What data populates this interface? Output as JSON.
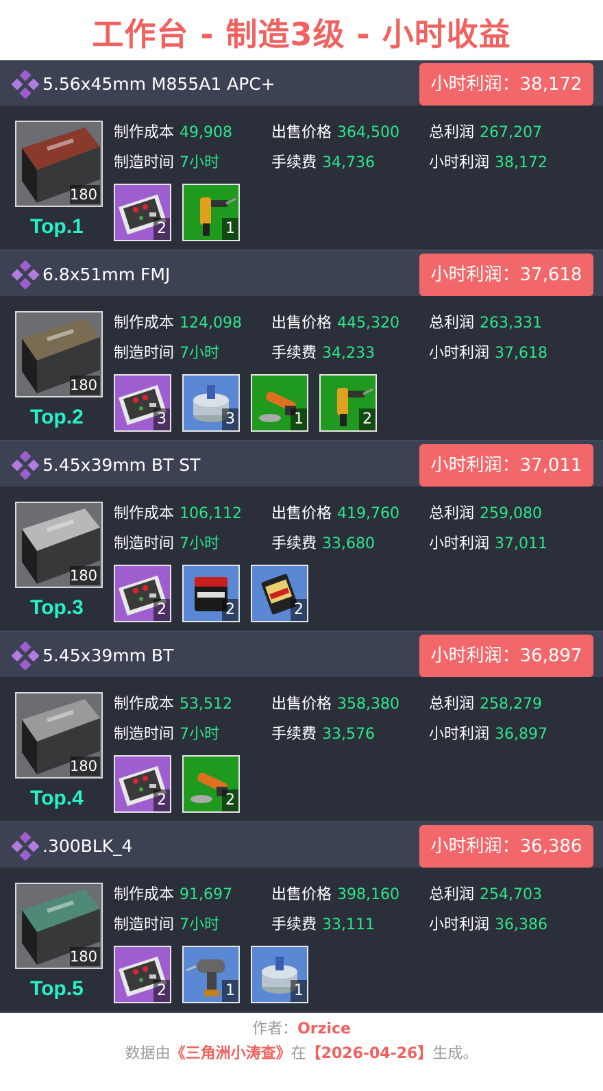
{
  "title": "工作台 - 制造3级 - 小时收益",
  "labels": {
    "cost": "制作成本",
    "price": "出售价格",
    "total": "总利润",
    "time": "制造时间",
    "fee": "手续费",
    "hourly": "小时利润"
  },
  "colors": {
    "title": "#f0625f",
    "card_bg": "#2b2f3a",
    "header_bg": "#3c4253",
    "badge": "#f2686a",
    "value": "#2de68a",
    "rank": "#25f3c9",
    "mat_purple": "#9f5ed0",
    "mat_green": "#1f9a1f",
    "mat_blue": "#5a88d4"
  },
  "items": [
    {
      "name": "5.56x45mm M855A1 APC+",
      "badge": "小时利润：38,172",
      "cost": "49,908",
      "price": "364,500",
      "total": "267,207",
      "time": "7小时",
      "fee": "34,736",
      "hourly": "38,172",
      "count": "180",
      "rank": "Top.1",
      "box_color": "#8a3a2a",
      "materials": [
        {
          "icon": "circuit-board-icon",
          "bg": "#9f5ed0",
          "count": "2"
        },
        {
          "icon": "soldering-gun-icon",
          "bg": "#1f9a1f",
          "count": "1"
        }
      ]
    },
    {
      "name": "6.8x51mm FMJ",
      "badge": "小时利润：37,618",
      "cost": "124,098",
      "price": "445,320",
      "total": "263,331",
      "time": "7小时",
      "fee": "34,233",
      "hourly": "37,618",
      "count": "180",
      "rank": "Top.2",
      "box_color": "#7a6c52",
      "materials": [
        {
          "icon": "circuit-board-icon",
          "bg": "#9f5ed0",
          "count": "3"
        },
        {
          "icon": "fuel-can-icon",
          "bg": "#5a88d4",
          "count": "3"
        },
        {
          "icon": "angle-grinder-icon",
          "bg": "#1f9a1f",
          "count": "1"
        },
        {
          "icon": "soldering-gun-icon",
          "bg": "#1f9a1f",
          "count": "2"
        }
      ]
    },
    {
      "name": "5.45x39mm BT ST",
      "badge": "小时利润：37,011",
      "cost": "106,112",
      "price": "419,760",
      "total": "259,080",
      "time": "7小时",
      "fee": "33,680",
      "hourly": "37,011",
      "count": "180",
      "rank": "Top.3",
      "box_color": "#b8b8b8",
      "materials": [
        {
          "icon": "circuit-board-icon",
          "bg": "#9f5ed0",
          "count": "2"
        },
        {
          "icon": "powder-jar-icon",
          "bg": "#5a88d4",
          "count": "2"
        },
        {
          "icon": "sd-card-icon",
          "bg": "#5a88d4",
          "count": "2"
        }
      ]
    },
    {
      "name": "5.45x39mm BT",
      "badge": "小时利润：36,897",
      "cost": "53,512",
      "price": "358,380",
      "total": "258,279",
      "time": "7小时",
      "fee": "33,576",
      "hourly": "36,897",
      "count": "180",
      "rank": "Top.4",
      "box_color": "#9a9a9a",
      "materials": [
        {
          "icon": "circuit-board-icon",
          "bg": "#9f5ed0",
          "count": "2"
        },
        {
          "icon": "angle-grinder-icon",
          "bg": "#1f9a1f",
          "count": "2"
        }
      ]
    },
    {
      "name": ".300BLK_4",
      "badge": "小时利润：36,386",
      "cost": "91,697",
      "price": "398,160",
      "total": "254,703",
      "time": "7小时",
      "fee": "33,111",
      "hourly": "36,386",
      "count": "180",
      "rank": "Top.5",
      "box_color": "#4f8a78",
      "materials": [
        {
          "icon": "circuit-board-icon",
          "bg": "#9f5ed0",
          "count": "2"
        },
        {
          "icon": "power-drill-icon",
          "bg": "#5a88d4",
          "count": "1"
        },
        {
          "icon": "fuel-can-icon",
          "bg": "#5a88d4",
          "count": "1"
        }
      ]
    }
  ],
  "footer": {
    "author_label": "作者：",
    "author": "Orzice",
    "source_prefix": "数据由",
    "source_name": "《三角洲小涛查》",
    "source_mid": "在",
    "date": "【2026-04-26】",
    "source_suffix": "生成。"
  }
}
